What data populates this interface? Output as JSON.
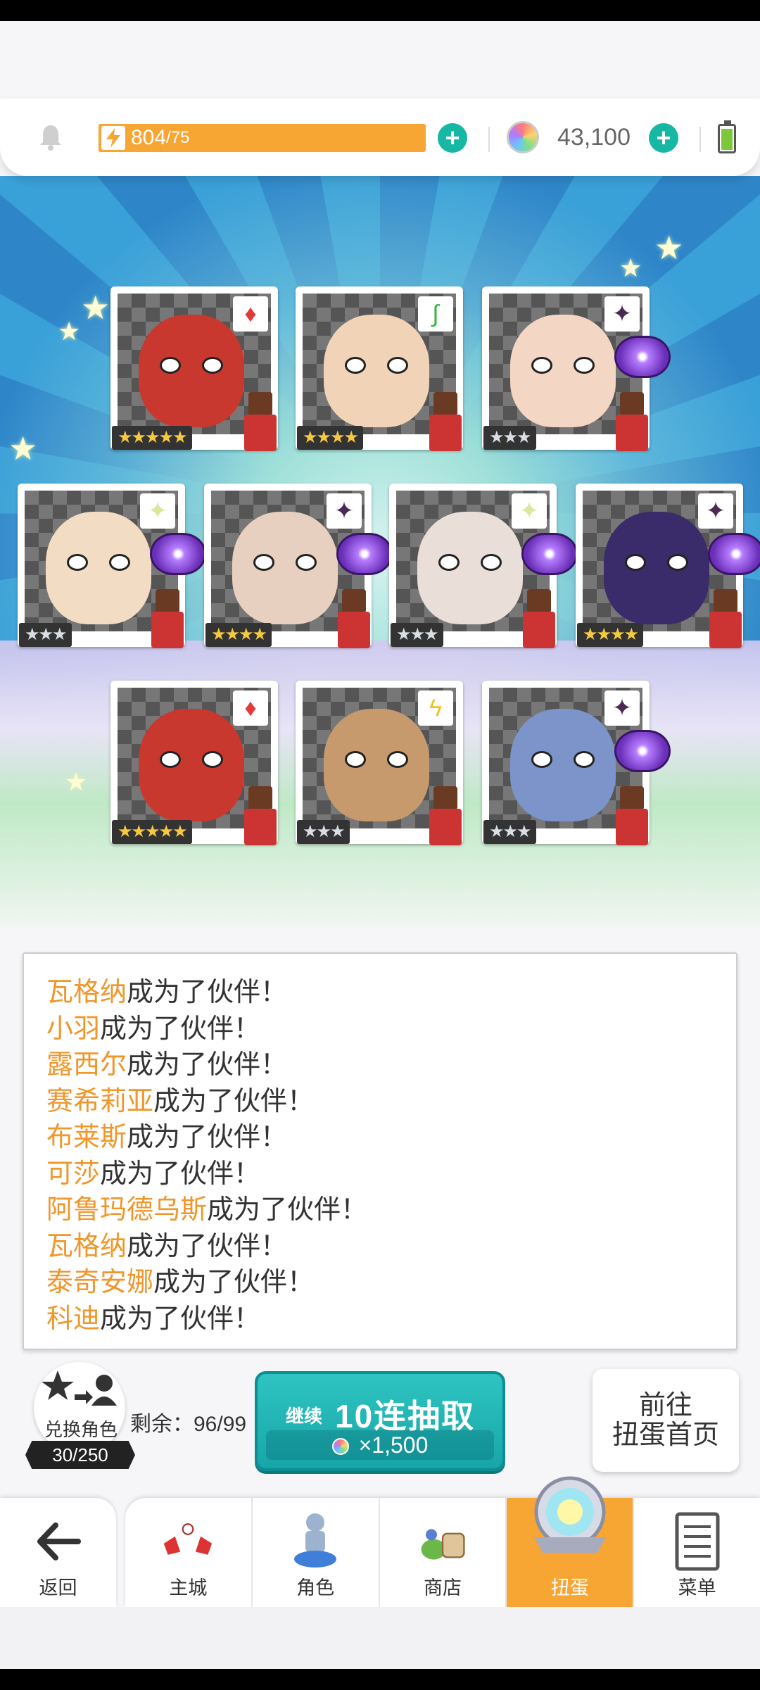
{
  "resources": {
    "stamina_value": "804",
    "stamina_max": "/75",
    "gems": "43,100"
  },
  "cards": [
    {
      "stars": "★★★★★",
      "rarity": "gold",
      "element": "fire",
      "elem_glyph": "♦",
      "elem_color": "#e23a3a",
      "face_color": "#c9382e"
    },
    {
      "stars": "★★★★",
      "rarity": "gold",
      "element": "wind",
      "elem_glyph": "∫",
      "elem_color": "#37b83a",
      "face_color": "#f1d4b8"
    },
    {
      "stars": "★★★",
      "rarity": "silver",
      "element": "dark",
      "elem_glyph": "✦",
      "elem_color": "#4a2a55",
      "face_color": "#f4d6c4"
    },
    {
      "stars": "★★★",
      "rarity": "silver",
      "element": "light",
      "elem_glyph": "✦",
      "elem_color": "#d9e89a",
      "face_color": "#f3dcc4"
    },
    {
      "stars": "★★★★",
      "rarity": "gold",
      "element": "dark",
      "elem_glyph": "✦",
      "elem_color": "#4a2a55",
      "face_color": "#e8d0c0"
    },
    {
      "stars": "★★★",
      "rarity": "silver",
      "element": "light",
      "elem_glyph": "✦",
      "elem_color": "#d9e89a",
      "face_color": "#eadfd8"
    },
    {
      "stars": "★★★★",
      "rarity": "gold",
      "element": "dark",
      "elem_glyph": "✦",
      "elem_color": "#4a2a55",
      "face_color": "#3a2b6a"
    },
    {
      "stars": "★★★★★",
      "rarity": "gold",
      "element": "fire",
      "elem_glyph": "♦",
      "elem_color": "#e23a3a",
      "face_color": "#c9382e"
    },
    {
      "stars": "★★★",
      "rarity": "silver",
      "element": "thunder",
      "elem_glyph": "ϟ",
      "elem_color": "#f2c21a",
      "face_color": "#c79a6e"
    },
    {
      "stars": "★★★",
      "rarity": "silver",
      "element": "dark",
      "elem_glyph": "✦",
      "elem_color": "#4a2a55",
      "face_color": "#7c94c9"
    }
  ],
  "log": {
    "suffix": "成为了伙伴！",
    "names": [
      "瓦格纳",
      "小羽",
      "露西尔",
      "赛希莉亚",
      "布莱斯",
      "可莎",
      "阿鲁玛德乌斯",
      "瓦格纳",
      "泰奇安娜",
      "科迪"
    ]
  },
  "actions": {
    "exchange_label": "兑换角色",
    "exchange_count": "30/250",
    "remain": "剩余：96/99",
    "pull_small": "继续",
    "pull_big": "10连抽取",
    "pull_cost": "×1,500",
    "goto_line1": "前往",
    "goto_line2": "扭蛋首页"
  },
  "nav": {
    "back": "返回",
    "tabs": [
      "主城",
      "角色",
      "商店",
      "扭蛋",
      "菜单"
    ]
  },
  "colors": {
    "accent_orange": "#f7a533",
    "teal": "#16b7a3",
    "name_orange": "#f0962a"
  }
}
